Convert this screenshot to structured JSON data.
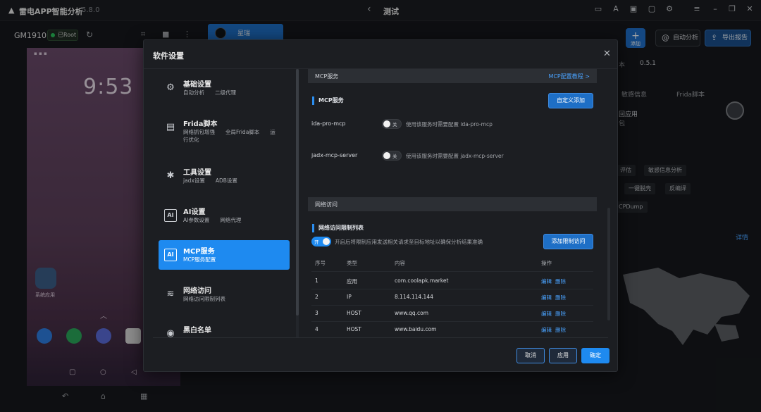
{
  "titlebar": {
    "app_name": "雷电APP智能分析",
    "version": "5.8.0",
    "page_title": "测试",
    "icons": [
      "monitor-icon",
      "font-icon",
      "briefcase-icon",
      "chat-icon",
      "gear-icon",
      "menu-icon",
      "minimize-icon",
      "restore-icon",
      "close-icon"
    ]
  },
  "device": {
    "name": "GM1910",
    "root_label": "已Root",
    "clock": "9:53",
    "app_label": "系统应用"
  },
  "phone_tab": {
    "label": "星瑞"
  },
  "header_actions": {
    "add_label": "添加",
    "auto_analyze": "自动分析",
    "export_report": "导出报告"
  },
  "background": {
    "version_label": "本",
    "version_value": "0.5.1",
    "tab_sensitive": "敏感信息",
    "tab_frida": "Frida脚本",
    "text_app": "回应用",
    "text_ba": "包",
    "chip_assess": "评估",
    "chip_sensitive": "敏感信息分析",
    "chip_unpack": "一键脱壳",
    "chip_decompile": "反编译",
    "chip_dump": "CPDump",
    "detail_link": "详情"
  },
  "modal": {
    "title": "软件设置",
    "nav": [
      {
        "title": "基础设置",
        "sub": "自动分析　　二级代理",
        "sub2": ""
      },
      {
        "title": "Frida脚本",
        "sub": "网络抓包增强　　全局Frida脚本　　运",
        "sub2": "行优化"
      },
      {
        "title": "工具设置",
        "sub": "jadx设置　　ADB设置",
        "sub2": ""
      },
      {
        "title": "AI设置",
        "sub": "AI参数设置　　网络代理",
        "sub2": ""
      },
      {
        "title": "MCP服务",
        "sub": "MCP服务配置",
        "sub2": ""
      },
      {
        "title": "网络访问",
        "sub": "网络访问限制列表",
        "sub2": ""
      },
      {
        "title": "黑白名单",
        "sub": "",
        "sub2": ""
      }
    ],
    "mcp": {
      "section_label": "MCP服务",
      "tutorial_link": "MCP配置教程 >",
      "sub_heading": "MCP服务",
      "custom_add": "自定义添加",
      "services": [
        {
          "name": "ida-pro-mcp",
          "toggle": "关",
          "hint": "使用该服务时需要配置 ida-pro-mcp"
        },
        {
          "name": "jadx-mcp-server",
          "toggle": "关",
          "hint": "使用该服务时需要配置 jadx-mcp-server"
        }
      ]
    },
    "network": {
      "section_label": "网络访问",
      "sub_heading": "网络访问限制列表",
      "toggle": "开",
      "hint": "开启后将限制应用发送相关请求至目标地址以确保分析结果准确",
      "add_button": "添加限制访问",
      "columns": [
        "序号",
        "类型",
        "内容",
        "操作"
      ],
      "rows": [
        {
          "no": "1",
          "type": "应用",
          "content": "com.coolapk.market",
          "edit": "编辑",
          "delete": "删除"
        },
        {
          "no": "2",
          "type": "IP",
          "content": "8.114.114.144",
          "edit": "编辑",
          "delete": "删除"
        },
        {
          "no": "3",
          "type": "HOST",
          "content": "www.qq.com",
          "edit": "编辑",
          "delete": "删除"
        },
        {
          "no": "4",
          "type": "HOST",
          "content": "www.baidu.com",
          "edit": "编辑",
          "delete": "删除"
        }
      ]
    },
    "footer": {
      "cancel": "取消",
      "apply": "应用",
      "ok": "确定"
    }
  },
  "colors": {
    "accent": "#1e8af0",
    "link": "#4aa3ff",
    "panel": "#1c1e22"
  }
}
